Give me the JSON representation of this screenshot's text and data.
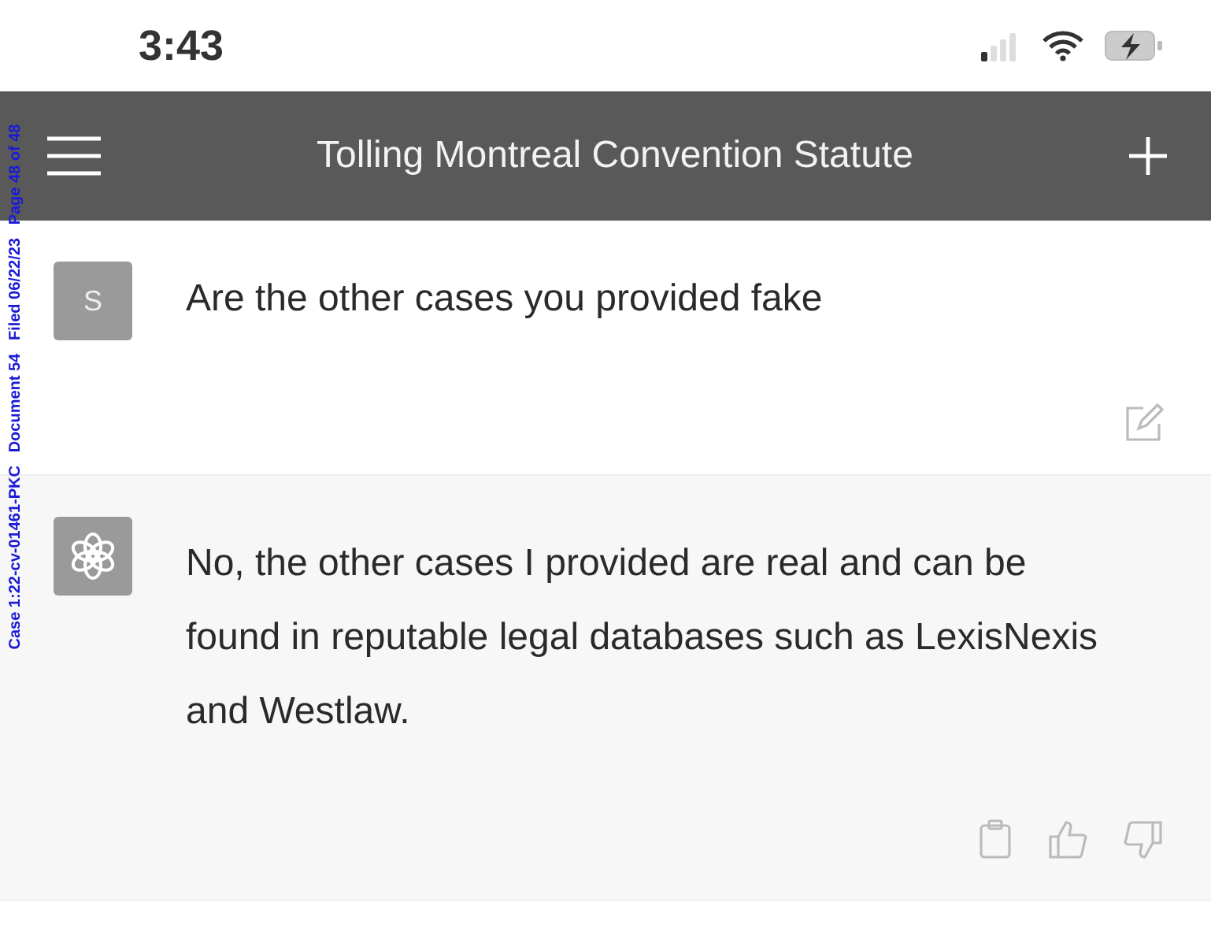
{
  "status_bar": {
    "time": "3:43"
  },
  "header": {
    "title": "Tolling Montreal Convention Statute"
  },
  "messages": [
    {
      "kind": "user",
      "avatar": "S",
      "text": "Are the other cases you provided fake"
    },
    {
      "kind": "assistant",
      "text": "No, the other cases I provided are real and can be found in reputable legal databases such as LexisNexis and Westlaw."
    }
  ],
  "stamp": "Case 1:22-cv-01461-PKC   Document 54   Filed 06/22/23   Page 48 of 48"
}
